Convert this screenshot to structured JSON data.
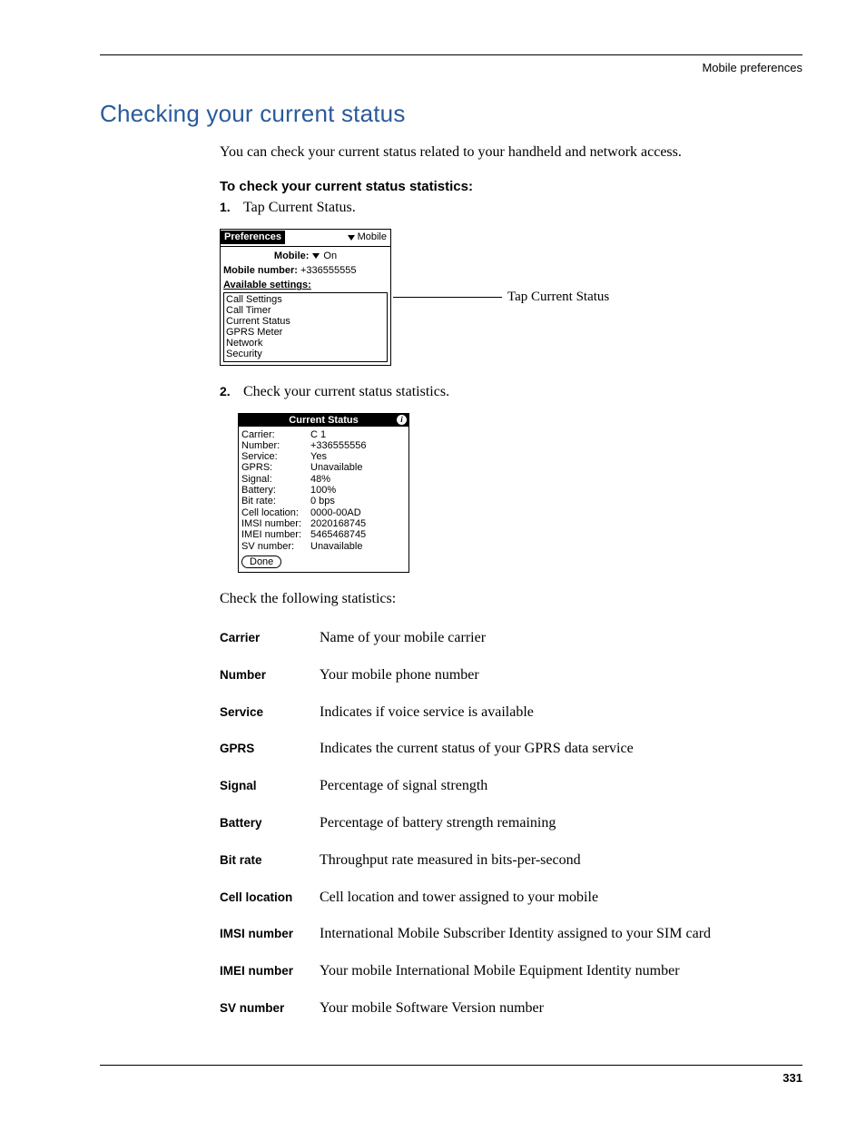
{
  "header": {
    "section": "Mobile preferences"
  },
  "title": "Checking your current status",
  "intro": "You can check your current status related to your handheld and network access.",
  "procedure_heading": "To check your current status statistics:",
  "steps": [
    {
      "num": "1.",
      "text": "Tap Current Status."
    },
    {
      "num": "2.",
      "text": "Check your current status statistics."
    }
  ],
  "callout": "Tap Current Status",
  "prefs_screen": {
    "title_tab": "Preferences",
    "title_drop": "Mobile",
    "mobile_label": "Mobile:",
    "mobile_value": "On",
    "number_label": "Mobile number:",
    "number_value": "+336555555",
    "avail_heading": "Available settings:",
    "settings": [
      "Call Settings",
      "Call Timer",
      "Current Status",
      "GPRS Meter",
      "Network",
      "Security"
    ]
  },
  "status_screen": {
    "title": "Current Status",
    "rows": [
      {
        "label": "Carrier:",
        "value": "C 1"
      },
      {
        "label": "Number:",
        "value": "+336555556"
      },
      {
        "label": "Service:",
        "value": "Yes"
      },
      {
        "label": "GPRS:",
        "value": "Unavailable"
      },
      {
        "label": "Signal:",
        "value": "48%"
      },
      {
        "label": "Battery:",
        "value": "100%"
      },
      {
        "label": "Bit rate:",
        "value": "0 bps"
      },
      {
        "label": "Cell location:",
        "value": "0000-00AD"
      },
      {
        "label": "IMSI number:",
        "value": "2020168745"
      },
      {
        "label": "IMEI number:",
        "value": "5465468745"
      },
      {
        "label": "SV number:",
        "value": "Unavailable"
      }
    ],
    "done": "Done"
  },
  "defs_intro": "Check the following statistics:",
  "defs": [
    {
      "term": "Carrier",
      "desc": "Name of your mobile carrier"
    },
    {
      "term": "Number",
      "desc": "Your mobile phone number"
    },
    {
      "term": "Service",
      "desc": "Indicates if voice service is available"
    },
    {
      "term": "GPRS",
      "desc": "Indicates the current status of your GPRS data service"
    },
    {
      "term": "Signal",
      "desc": "Percentage of signal strength"
    },
    {
      "term": "Battery",
      "desc": "Percentage of battery strength remaining"
    },
    {
      "term": "Bit rate",
      "desc": "Throughput rate measured in bits-per-second"
    },
    {
      "term": "Cell location",
      "desc": "Cell location and tower assigned to your mobile"
    },
    {
      "term": "IMSI number",
      "desc": "International Mobile Subscriber Identity assigned to your SIM card"
    },
    {
      "term": "IMEI number",
      "desc": "Your mobile International Mobile Equipment Identity number"
    },
    {
      "term": "SV number",
      "desc": "Your mobile Software Version number"
    }
  ],
  "page_number": "331"
}
